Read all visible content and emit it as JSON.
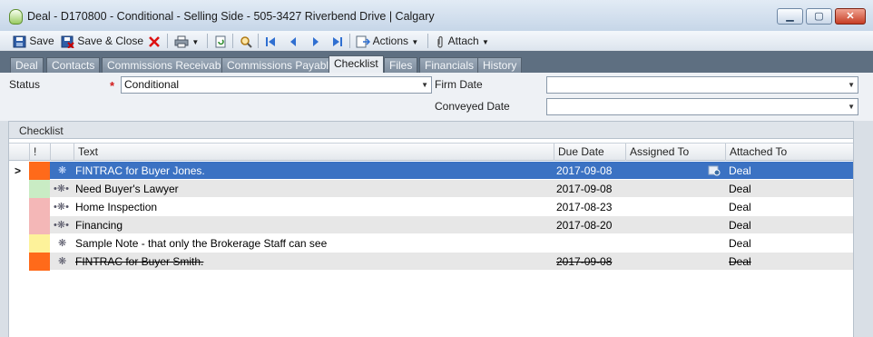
{
  "window": {
    "title": "Deal - D170800 - Conditional - Selling Side - 505-3427 Riverbend Drive | Calgary",
    "minimize_glyph": "▁",
    "restore_glyph": "▢",
    "close_glyph": "✕"
  },
  "toolbar": {
    "save_label": "Save",
    "save_close_label": "Save & Close",
    "actions_label": "Actions",
    "attach_label": "Attach"
  },
  "tabs": [
    "Deal",
    "Contacts",
    "Commissions Receivable",
    "Commissions Payable",
    "Checklist",
    "Files",
    "Financials",
    "History"
  ],
  "active_tab": "Checklist",
  "form": {
    "status_label": "Status",
    "status_value": "Conditional",
    "firm_date_label": "Firm Date",
    "firm_date_value": "",
    "conveyed_date_label": "Conveyed Date",
    "conveyed_date_value": ""
  },
  "checklist": {
    "section_label": "Checklist",
    "columns": {
      "flag": "!",
      "text": "Text",
      "due": "Due Date",
      "assigned": "Assigned To",
      "attached": "Attached To"
    },
    "rows": [
      {
        "text": "FINTRAC for Buyer Jones.",
        "due": "2017-09-08",
        "assigned": "",
        "attached": "Deal",
        "flag_color": "#ff6a1a",
        "selected": true,
        "struck": false
      },
      {
        "text": "Need Buyer's Lawyer",
        "due": "2017-09-08",
        "assigned": "",
        "attached": "Deal",
        "flag_color": "#c9ecc4",
        "selected": false,
        "struck": false
      },
      {
        "text": "Home Inspection",
        "due": "2017-08-23",
        "assigned": "",
        "attached": "Deal",
        "flag_color": "#f4b7b7",
        "selected": false,
        "struck": false
      },
      {
        "text": "Financing",
        "due": "2017-08-20",
        "assigned": "",
        "attached": "Deal",
        "flag_color": "#f4b7b7",
        "selected": false,
        "struck": false
      },
      {
        "text": "Sample Note - that only the Brokerage Staff can see",
        "due": "",
        "assigned": "",
        "attached": "Deal",
        "flag_color": "#fdf29a",
        "selected": false,
        "struck": false
      },
      {
        "text": "FINTRAC for Buyer Smith.",
        "due": "2017-09-08",
        "assigned": "",
        "attached": "Deal",
        "flag_color": "#ff6a1a",
        "selected": false,
        "struck": true
      }
    ]
  }
}
